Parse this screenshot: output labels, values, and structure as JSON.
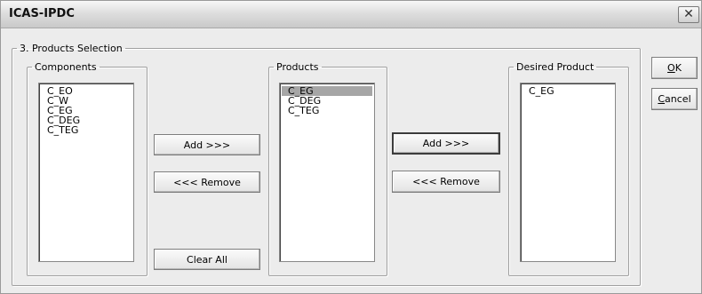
{
  "window": {
    "title": "ICAS-IPDC",
    "close_glyph": "✕"
  },
  "section": {
    "title": "3. Products Selection"
  },
  "components": {
    "title": "Components",
    "items": [
      "C_EO",
      "C_W",
      "C_EG",
      "C_DEG",
      "C_TEG"
    ]
  },
  "products": {
    "title": "Products",
    "items": [
      "C_EG",
      "C_DEG",
      "C_TEG"
    ],
    "selected_index": 0
  },
  "desired": {
    "title": "Desired Product",
    "items": [
      "C_EG"
    ]
  },
  "buttons": {
    "add_1": "Add >>>",
    "remove_1": "<<< Remove",
    "clear_all": "Clear All",
    "add_2": "Add >>>",
    "remove_2": "<<< Remove",
    "ok_mnemonic": "O",
    "ok_rest": "K",
    "cancel_mnemonic": "C",
    "cancel_rest": "ancel"
  },
  "colors": {
    "selection_bg": "#a6a6a6",
    "dialog_bg": "#ececec"
  }
}
